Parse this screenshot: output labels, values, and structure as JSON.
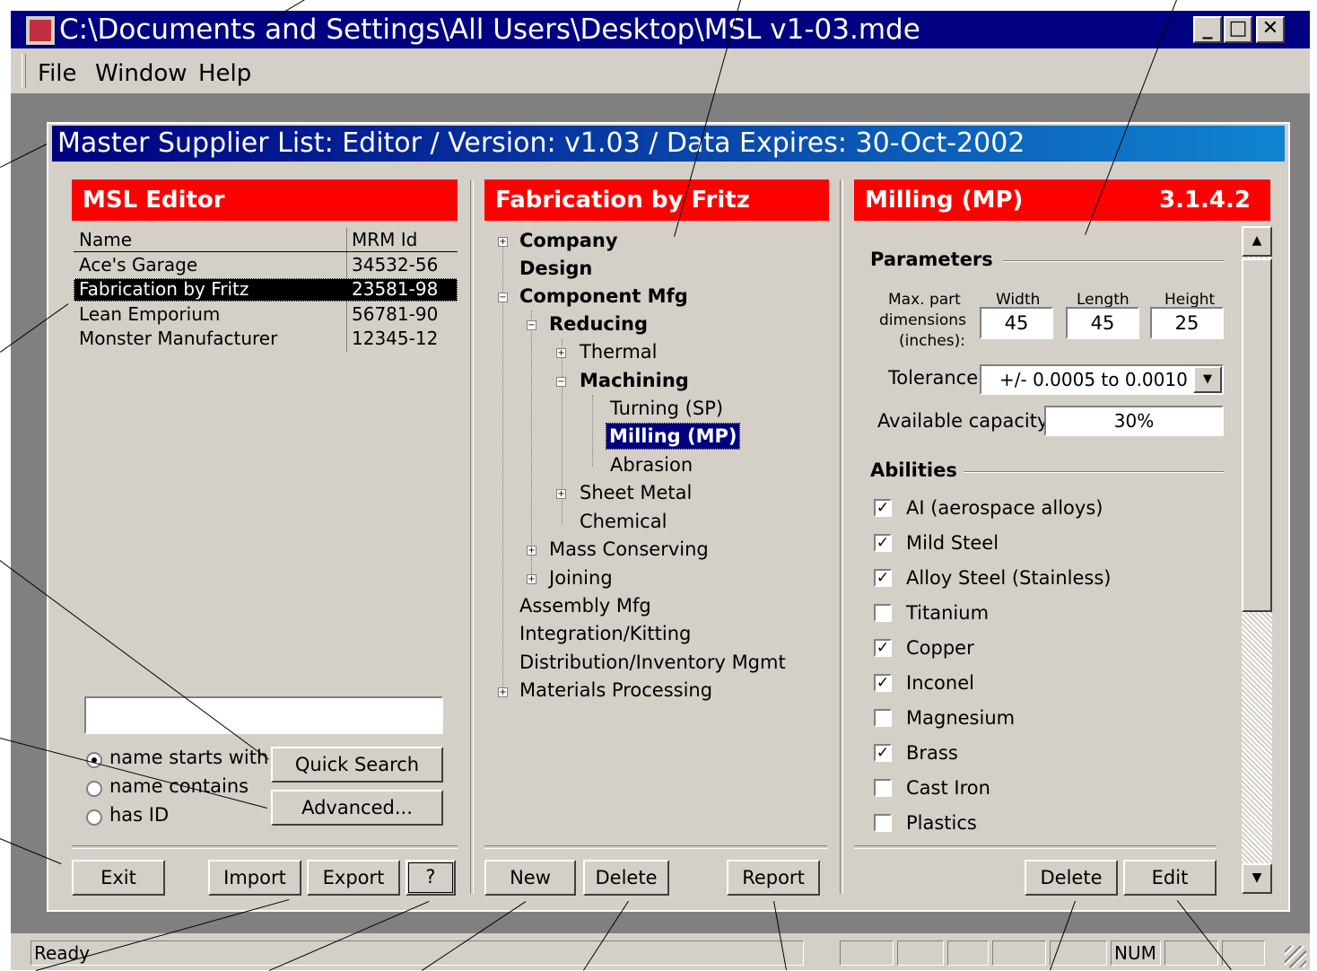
{
  "window": {
    "title": "C:\\Documents and Settings\\All Users\\Desktop\\MSL v1-03.mde",
    "minimize_glyph": "_",
    "maximize_glyph": "□",
    "close_glyph": "✕"
  },
  "menu": {
    "file": "File",
    "window": "Window",
    "help": "Help"
  },
  "child_title": "Master Supplier List: Editor  /  Version: v1.03  /  Data Expires: 30-Oct-2002",
  "left_panel": {
    "header": "MSL Editor",
    "columns": {
      "name": "Name",
      "id": "MRM Id"
    },
    "rows": [
      {
        "name": "Ace's Garage",
        "id": "34532-56"
      },
      {
        "name": "Fabrication by Fritz",
        "id": "23581-98"
      },
      {
        "name": "Lean Emporium",
        "id": "56781-90"
      },
      {
        "name": "Monster Manufacturer",
        "id": "12345-12"
      }
    ],
    "search_value": "",
    "radios": {
      "starts": "name starts with",
      "contains": "name contains",
      "has_id": "has ID"
    },
    "quick_search": "Quick Search",
    "advanced": "Advanced...",
    "exit": "Exit",
    "import": "Import",
    "export": "Export",
    "help": "?"
  },
  "middle_panel": {
    "header": "Fabrication by Fritz",
    "tree": {
      "company": "Company",
      "design": "Design",
      "component_mfg": "Component Mfg",
      "reducing": "Reducing",
      "thermal": "Thermal",
      "machining": "Machining",
      "turning": "Turning (SP)",
      "milling": "Milling (MP)",
      "abrasion": "Abrasion",
      "sheet_metal": "Sheet Metal",
      "chemical": "Chemical",
      "mass_conserving": "Mass Conserving",
      "joining": "Joining",
      "assembly": "Assembly Mfg",
      "integration": "Integration/Kitting",
      "distribution": "Distribution/Inventory Mgmt",
      "materials": "Materials Processing"
    },
    "new": "New",
    "delete": "Delete",
    "report": "Report"
  },
  "right_panel": {
    "header": "Milling (MP)",
    "code": "3.1.4.2",
    "parameters_label": "Parameters",
    "max_dims_label_1": "Max. part",
    "max_dims_label_2": "dimensions",
    "max_dims_label_3": "(inches):",
    "width_label": "Width",
    "length_label": "Length",
    "height_label": "Height",
    "width": "45",
    "length": "45",
    "height": "25",
    "tolerance_label": "Tolerance",
    "tolerance": "+/- 0.0005 to 0.0010",
    "capacity_label": "Available capacity:",
    "capacity": "30%",
    "abilities_label": "Abilities",
    "abilities": [
      {
        "label": "AI (aerospace alloys)",
        "checked": true
      },
      {
        "label": "Mild Steel",
        "checked": true
      },
      {
        "label": "Alloy Steel (Stainless)",
        "checked": true
      },
      {
        "label": "Titanium",
        "checked": false
      },
      {
        "label": "Copper",
        "checked": true
      },
      {
        "label": "Inconel",
        "checked": true
      },
      {
        "label": "Magnesium",
        "checked": false
      },
      {
        "label": "Brass",
        "checked": true
      },
      {
        "label": "Cast Iron",
        "checked": false
      },
      {
        "label": "Plastics",
        "checked": false
      }
    ],
    "delete": "Delete",
    "edit": "Edit"
  },
  "status": {
    "ready": "Ready",
    "num": "NUM"
  }
}
